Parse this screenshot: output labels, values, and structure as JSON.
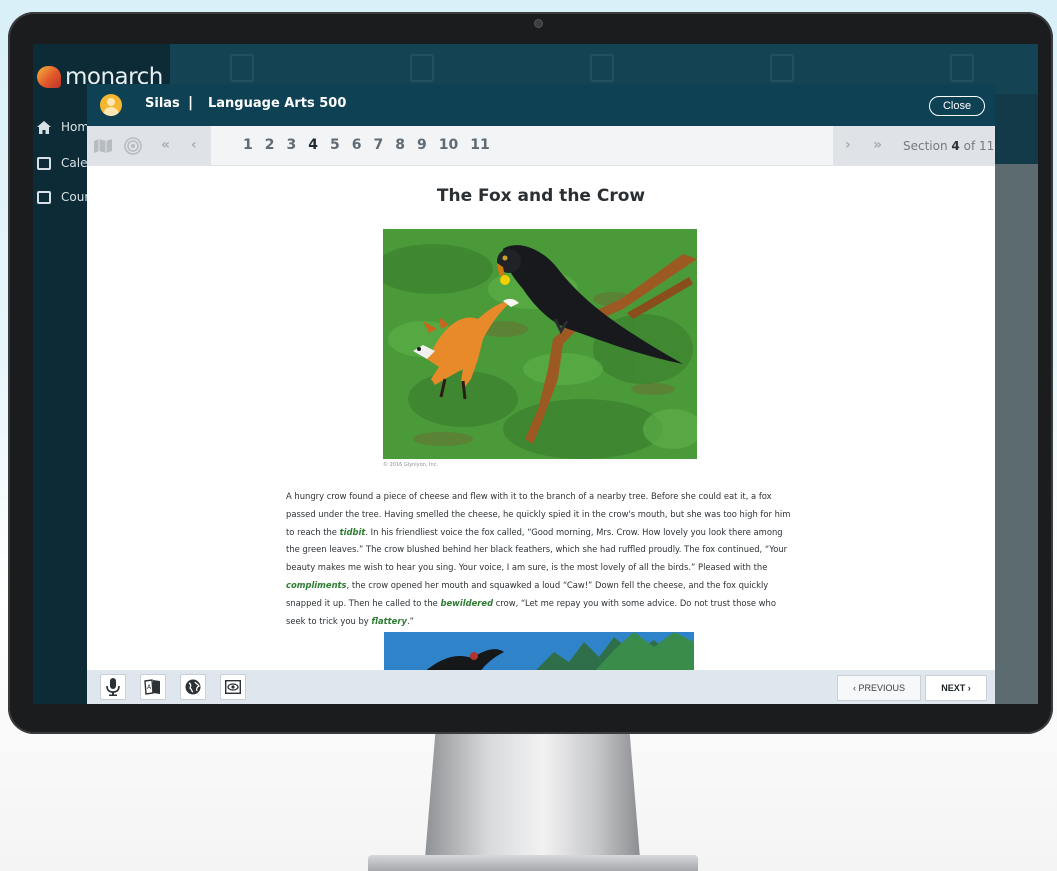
{
  "app": {
    "brand": "monarch",
    "nav_items": [
      {
        "label": "Hom",
        "icon": "home-icon"
      },
      {
        "label": "Cale",
        "icon": "calendar-icon"
      },
      {
        "label": "Cour",
        "icon": "book-icon"
      }
    ]
  },
  "header": {
    "student": "Silas",
    "separator": "|",
    "course": "Language Arts 500",
    "close_label": "Close"
  },
  "toolbar": {
    "icons": [
      "map-icon",
      "target-icon",
      "first-page-icon",
      "previous-page-icon"
    ],
    "pages": [
      "1",
      "2",
      "3",
      "4",
      "5",
      "6",
      "7",
      "8",
      "9",
      "10",
      "11"
    ],
    "current_page": "4",
    "next_symbol": "›",
    "last_symbol": "»",
    "first_symbol": "«",
    "prev_symbol": "‹",
    "section_prefix": "Section",
    "section_current": "4",
    "section_suffix": "of 11"
  },
  "story": {
    "title": "The Fox and the Crow",
    "image_credit": "© 2016 Glynlyon, Inc.",
    "text": [
      {
        "t": "A hungry crow found a piece of cheese and flew with it to the branch of a nearby tree. Before she could eat it, a fox passed under the tree. Having smelled the cheese, he quickly spied it in the crow's mouth, but she was too high for him to reach the "
      },
      {
        "t": "tidbit",
        "vocab": true
      },
      {
        "t": ". In his friendliest voice the fox called, “Good morning, Mrs. Crow. How lovely you look there among the green leaves.” The crow blushed behind her black feathers, which she had ruffled proudly. The fox continued, “Your beauty makes me wish to hear you sing. Your voice, I am sure, is the most lovely of all the birds.” Pleased with the "
      },
      {
        "t": "compliments",
        "vocab": true
      },
      {
        "t": ", the crow opened her mouth and squawked a loud “Caw!” Down fell the cheese, and the fox quickly snapped it up. Then he called to the "
      },
      {
        "t": "bewildered",
        "vocab": true
      },
      {
        "t": " crow, “Let me repay you with some advice. Do not trust those who seek to trick you by "
      },
      {
        "t": "flattery",
        "vocab": true
      },
      {
        "t": ".”"
      }
    ]
  },
  "bottom": {
    "tools": [
      "microphone-icon",
      "dictionary-icon",
      "globe-icon",
      "eye-icon"
    ],
    "previous_label": "‹  PREVIOUS",
    "next_label": "NEXT  ›"
  },
  "colors": {
    "header_bg": "#0f4155",
    "vocab": "#2e7d32",
    "avatar": "#f5b731"
  }
}
